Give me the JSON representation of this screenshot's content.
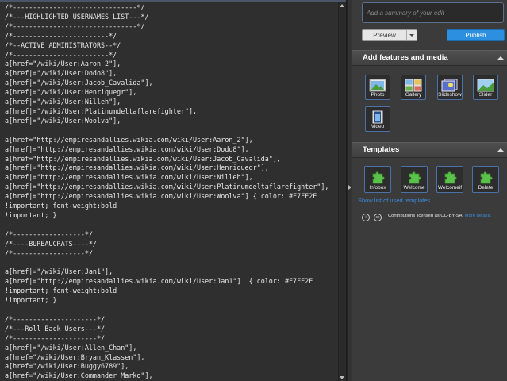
{
  "editor": {
    "lines": [
      "/*-------------------------------*/",
      "/*---HIGHLIGHTED USERNAMES LIST---*/",
      "/*-------------------------------*/",
      "/*------------------------*/",
      "/*--ACTIVE ADMINISTRATORS--*/",
      "/*------------------------*/",
      "a[href=\"/wiki/User:Aaron_2\"],",
      "a[href|=\"/wiki/User:Dodo8\"],",
      "a[href|=\"/wiki/User:Jacob_Cavalida\"],",
      "a[href|=\"/wiki/User:Henriquegr\"],",
      "a[href|=\"/wiki/User:Nilleh\"],",
      "a[href|=\"/wiki/User:Platinumdeltaflarefighter\"],",
      "a[href|=\"/wiki/User:Woolva\"],",
      "",
      "a[href=\"http://empiresandallies.wikia.com/wiki/User:Aaron_2\"],",
      "a[href|=\"http://empiresandallies.wikia.com/wiki/User:Dodo8\"],",
      "a[href=\"http://empiresandallies.wikia.com/wiki/User:Jacob_Cavalida\"],",
      "a[href|=\"http://empiresandallies.wikia.com/wiki/User:Henriquegr\"],",
      "a[href|=\"http://empiresandallies.wikia.com/wiki/User:Nilleh\"],",
      "a[href|=\"http://empiresandallies.wikia.com/wiki/User:Platinumdeltaflarefighter\"],",
      "a[href|=\"http://empiresandallies.wikia.com/wiki/User:Woolva\"] { color: #F7FE2E",
      "!important; font-weight:bold",
      "!important; }",
      "",
      "/*------------------*/",
      "/*----BUREAUCRATS----*/",
      "/*------------------*/",
      "",
      "a[href|=\"/wiki/User:Jan1\"],",
      "a[href|=\"http://empiresandallies.wikia.com/wiki/User:Jan1\"]  { color: #F7FE2E",
      "!important; font-weight:bold",
      "!important; }",
      "",
      "/*---------------------*/",
      "/*---Roll Back Users---*/",
      "/*---------------------*/",
      "a[href|=\"/wiki/User:Allen_Chan\"],",
      "a[href=\"/wiki/User:Bryan_Klassen\"],",
      "a[href=\"/wiki/User:Buggy6789\"],",
      "a[href=\"/wiki/User:Commander_Marko\"],"
    ]
  },
  "summary": {
    "placeholder": "Add a summary of your edit"
  },
  "buttons": {
    "preview": "Preview",
    "publish": "Publish"
  },
  "features": {
    "title": "Add features and media",
    "tools": [
      "Photo",
      "Gallery",
      "Slideshow",
      "Slider",
      "Video"
    ]
  },
  "templates": {
    "title": "Templates",
    "items": [
      "Infobox",
      "Welcome",
      "Welcomeif",
      "Delete"
    ],
    "show_link": "Show list of used templates"
  },
  "license": {
    "text": "Contributions licensed as CC-BY-SA.",
    "more": "More details."
  },
  "colors": {
    "accent": "#2d8fe0",
    "link": "#3b8de0",
    "puzzle": "#5ac24a"
  }
}
